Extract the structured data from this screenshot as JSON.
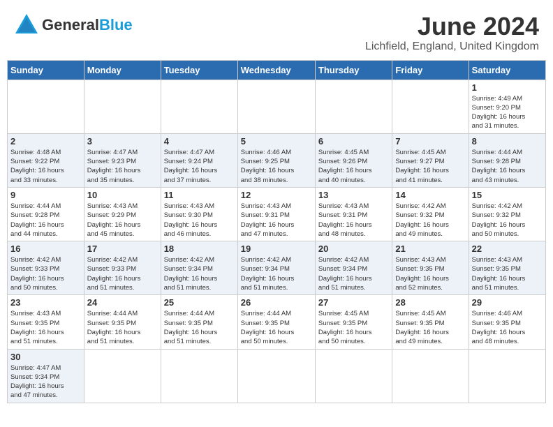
{
  "header": {
    "logo_general": "General",
    "logo_blue": "Blue",
    "month": "June 2024",
    "location": "Lichfield, England, United Kingdom"
  },
  "weekdays": [
    "Sunday",
    "Monday",
    "Tuesday",
    "Wednesday",
    "Thursday",
    "Friday",
    "Saturday"
  ],
  "weeks": [
    [
      {
        "day": "",
        "info": ""
      },
      {
        "day": "",
        "info": ""
      },
      {
        "day": "",
        "info": ""
      },
      {
        "day": "",
        "info": ""
      },
      {
        "day": "",
        "info": ""
      },
      {
        "day": "",
        "info": ""
      },
      {
        "day": "1",
        "info": "Sunrise: 4:49 AM\nSunset: 9:20 PM\nDaylight: 16 hours\nand 31 minutes."
      }
    ],
    [
      {
        "day": "2",
        "info": "Sunrise: 4:48 AM\nSunset: 9:22 PM\nDaylight: 16 hours\nand 33 minutes."
      },
      {
        "day": "3",
        "info": "Sunrise: 4:47 AM\nSunset: 9:23 PM\nDaylight: 16 hours\nand 35 minutes."
      },
      {
        "day": "4",
        "info": "Sunrise: 4:47 AM\nSunset: 9:24 PM\nDaylight: 16 hours\nand 37 minutes."
      },
      {
        "day": "5",
        "info": "Sunrise: 4:46 AM\nSunset: 9:25 PM\nDaylight: 16 hours\nand 38 minutes."
      },
      {
        "day": "6",
        "info": "Sunrise: 4:45 AM\nSunset: 9:26 PM\nDaylight: 16 hours\nand 40 minutes."
      },
      {
        "day": "7",
        "info": "Sunrise: 4:45 AM\nSunset: 9:27 PM\nDaylight: 16 hours\nand 41 minutes."
      },
      {
        "day": "8",
        "info": "Sunrise: 4:44 AM\nSunset: 9:28 PM\nDaylight: 16 hours\nand 43 minutes."
      }
    ],
    [
      {
        "day": "9",
        "info": "Sunrise: 4:44 AM\nSunset: 9:28 PM\nDaylight: 16 hours\nand 44 minutes."
      },
      {
        "day": "10",
        "info": "Sunrise: 4:43 AM\nSunset: 9:29 PM\nDaylight: 16 hours\nand 45 minutes."
      },
      {
        "day": "11",
        "info": "Sunrise: 4:43 AM\nSunset: 9:30 PM\nDaylight: 16 hours\nand 46 minutes."
      },
      {
        "day": "12",
        "info": "Sunrise: 4:43 AM\nSunset: 9:31 PM\nDaylight: 16 hours\nand 47 minutes."
      },
      {
        "day": "13",
        "info": "Sunrise: 4:43 AM\nSunset: 9:31 PM\nDaylight: 16 hours\nand 48 minutes."
      },
      {
        "day": "14",
        "info": "Sunrise: 4:42 AM\nSunset: 9:32 PM\nDaylight: 16 hours\nand 49 minutes."
      },
      {
        "day": "15",
        "info": "Sunrise: 4:42 AM\nSunset: 9:32 PM\nDaylight: 16 hours\nand 50 minutes."
      }
    ],
    [
      {
        "day": "16",
        "info": "Sunrise: 4:42 AM\nSunset: 9:33 PM\nDaylight: 16 hours\nand 50 minutes."
      },
      {
        "day": "17",
        "info": "Sunrise: 4:42 AM\nSunset: 9:33 PM\nDaylight: 16 hours\nand 51 minutes."
      },
      {
        "day": "18",
        "info": "Sunrise: 4:42 AM\nSunset: 9:34 PM\nDaylight: 16 hours\nand 51 minutes."
      },
      {
        "day": "19",
        "info": "Sunrise: 4:42 AM\nSunset: 9:34 PM\nDaylight: 16 hours\nand 51 minutes."
      },
      {
        "day": "20",
        "info": "Sunrise: 4:42 AM\nSunset: 9:34 PM\nDaylight: 16 hours\nand 51 minutes."
      },
      {
        "day": "21",
        "info": "Sunrise: 4:43 AM\nSunset: 9:35 PM\nDaylight: 16 hours\nand 52 minutes."
      },
      {
        "day": "22",
        "info": "Sunrise: 4:43 AM\nSunset: 9:35 PM\nDaylight: 16 hours\nand 51 minutes."
      }
    ],
    [
      {
        "day": "23",
        "info": "Sunrise: 4:43 AM\nSunset: 9:35 PM\nDaylight: 16 hours\nand 51 minutes."
      },
      {
        "day": "24",
        "info": "Sunrise: 4:44 AM\nSunset: 9:35 PM\nDaylight: 16 hours\nand 51 minutes."
      },
      {
        "day": "25",
        "info": "Sunrise: 4:44 AM\nSunset: 9:35 PM\nDaylight: 16 hours\nand 51 minutes."
      },
      {
        "day": "26",
        "info": "Sunrise: 4:44 AM\nSunset: 9:35 PM\nDaylight: 16 hours\nand 50 minutes."
      },
      {
        "day": "27",
        "info": "Sunrise: 4:45 AM\nSunset: 9:35 PM\nDaylight: 16 hours\nand 50 minutes."
      },
      {
        "day": "28",
        "info": "Sunrise: 4:45 AM\nSunset: 9:35 PM\nDaylight: 16 hours\nand 49 minutes."
      },
      {
        "day": "29",
        "info": "Sunrise: 4:46 AM\nSunset: 9:35 PM\nDaylight: 16 hours\nand 48 minutes."
      }
    ],
    [
      {
        "day": "30",
        "info": "Sunrise: 4:47 AM\nSunset: 9:34 PM\nDaylight: 16 hours\nand 47 minutes."
      },
      {
        "day": "",
        "info": ""
      },
      {
        "day": "",
        "info": ""
      },
      {
        "day": "",
        "info": ""
      },
      {
        "day": "",
        "info": ""
      },
      {
        "day": "",
        "info": ""
      },
      {
        "day": "",
        "info": ""
      }
    ]
  ]
}
